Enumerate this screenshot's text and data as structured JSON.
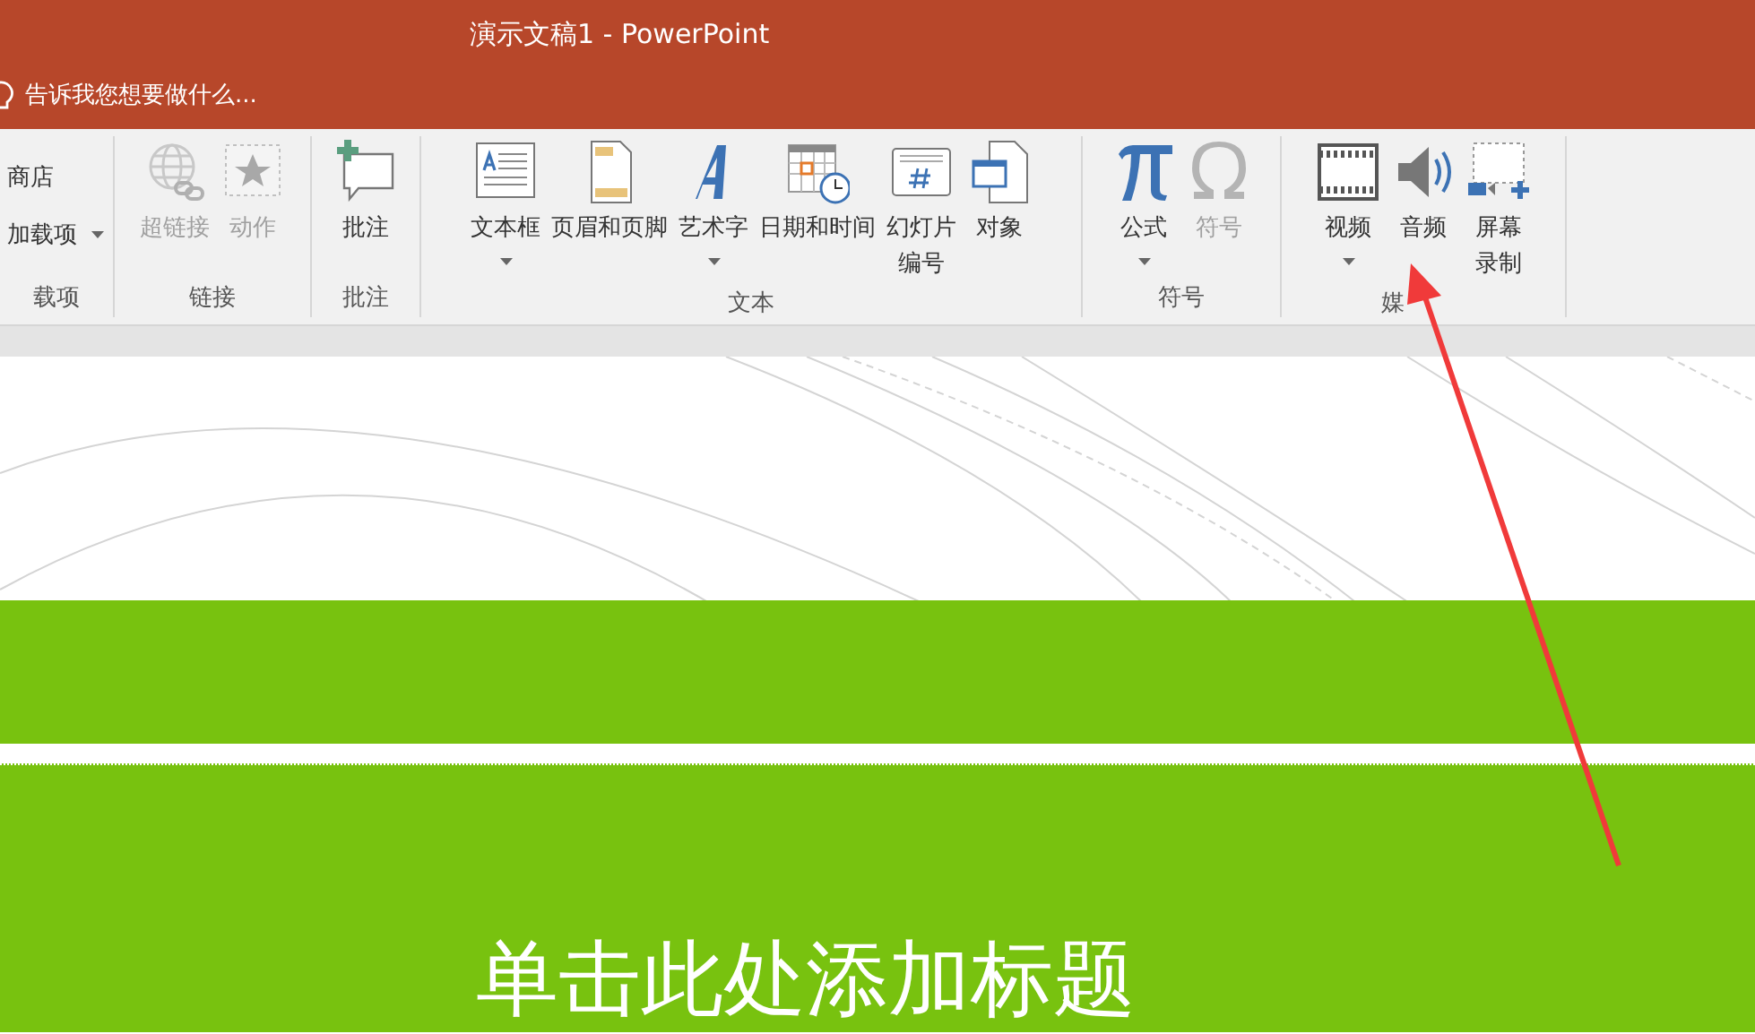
{
  "window": {
    "title": "演示文稿1 - PowerPoint"
  },
  "tell_me": {
    "placeholder": "告诉我您想要做什么..."
  },
  "ribbon": {
    "groups": [
      {
        "label": "载项",
        "items": [
          {
            "kind": "small",
            "label": "商店",
            "disabled": false,
            "dropdown": false
          },
          {
            "kind": "small",
            "label": "加载项",
            "disabled": false,
            "dropdown": true
          }
        ]
      },
      {
        "label": "链接",
        "items": [
          {
            "kind": "large",
            "label": "超链接",
            "disabled": true,
            "dropdown": false
          },
          {
            "kind": "large",
            "label": "动作",
            "disabled": true,
            "dropdown": false
          }
        ]
      },
      {
        "label": "批注",
        "items": [
          {
            "kind": "large",
            "label": "批注",
            "disabled": false,
            "dropdown": false
          }
        ]
      },
      {
        "label": "文本",
        "items": [
          {
            "kind": "large",
            "label": "文本框",
            "disabled": false,
            "dropdown": true
          },
          {
            "kind": "large",
            "label": "页眉和页脚",
            "disabled": false,
            "dropdown": false
          },
          {
            "kind": "large",
            "label": "艺术字",
            "disabled": false,
            "dropdown": true
          },
          {
            "kind": "large",
            "label": "日期和时间",
            "disabled": false,
            "dropdown": false
          },
          {
            "kind": "large",
            "label": "幻灯片编号",
            "disabled": false,
            "dropdown": false
          },
          {
            "kind": "large",
            "label": "对象",
            "disabled": false,
            "dropdown": false
          }
        ]
      },
      {
        "label": "符号",
        "items": [
          {
            "kind": "large",
            "label": "公式",
            "disabled": false,
            "dropdown": true
          },
          {
            "kind": "large",
            "label": "符号",
            "disabled": true,
            "dropdown": false
          }
        ]
      },
      {
        "label": "媒",
        "items": [
          {
            "kind": "large",
            "label": "视频",
            "disabled": false,
            "dropdown": true
          },
          {
            "kind": "large",
            "label": "音频",
            "disabled": false,
            "dropdown": false
          },
          {
            "kind": "large",
            "label": "屏幕录制",
            "disabled": false,
            "dropdown": false
          }
        ]
      }
    ]
  },
  "slide": {
    "title": "单击此处添加标题"
  }
}
